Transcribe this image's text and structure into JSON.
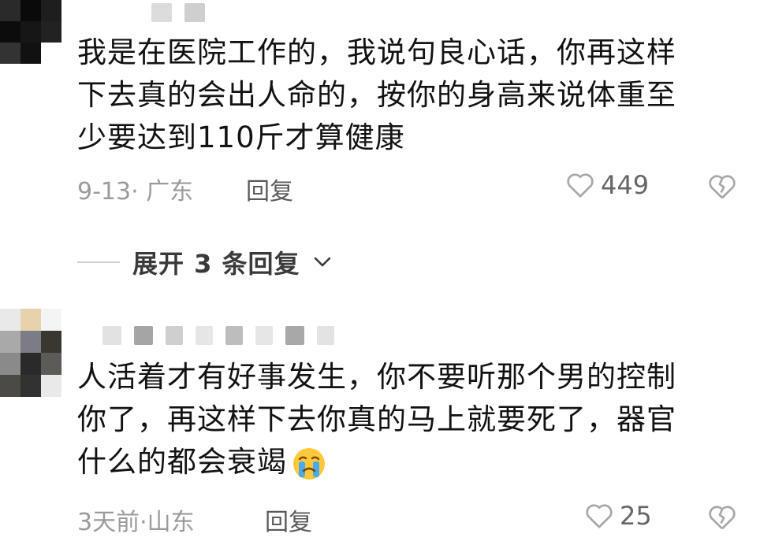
{
  "comments": [
    {
      "lines": [
        "我是在医院工作的，我说句良心话，你再这样",
        "下去真的会出人命的，按你的身高来说体重至",
        "少要达到110斤才算健康"
      ],
      "date": "9-13",
      "separator": "·",
      "location": "广东",
      "reply_label": "回复",
      "likes": "449"
    },
    {
      "lines": [
        "人活着才有好事发生，你不要听那个男的控制",
        "你了，再这样下去你真的马上就要死了，器官",
        "什么的都会衰竭"
      ],
      "emoji": "crying-face",
      "date": "3天前",
      "separator": "·",
      "location": "山东",
      "reply_label": "回复",
      "likes": "25"
    }
  ],
  "expand": {
    "label": "展开 3 条回复"
  },
  "colors": {
    "meta": "#9b9b9b",
    "text": "#121212",
    "icon": "#a8a8a8"
  },
  "icons": {
    "like": "heart-outline-icon",
    "dislike": "broken-heart-icon",
    "chevron": "chevron-down-icon"
  }
}
